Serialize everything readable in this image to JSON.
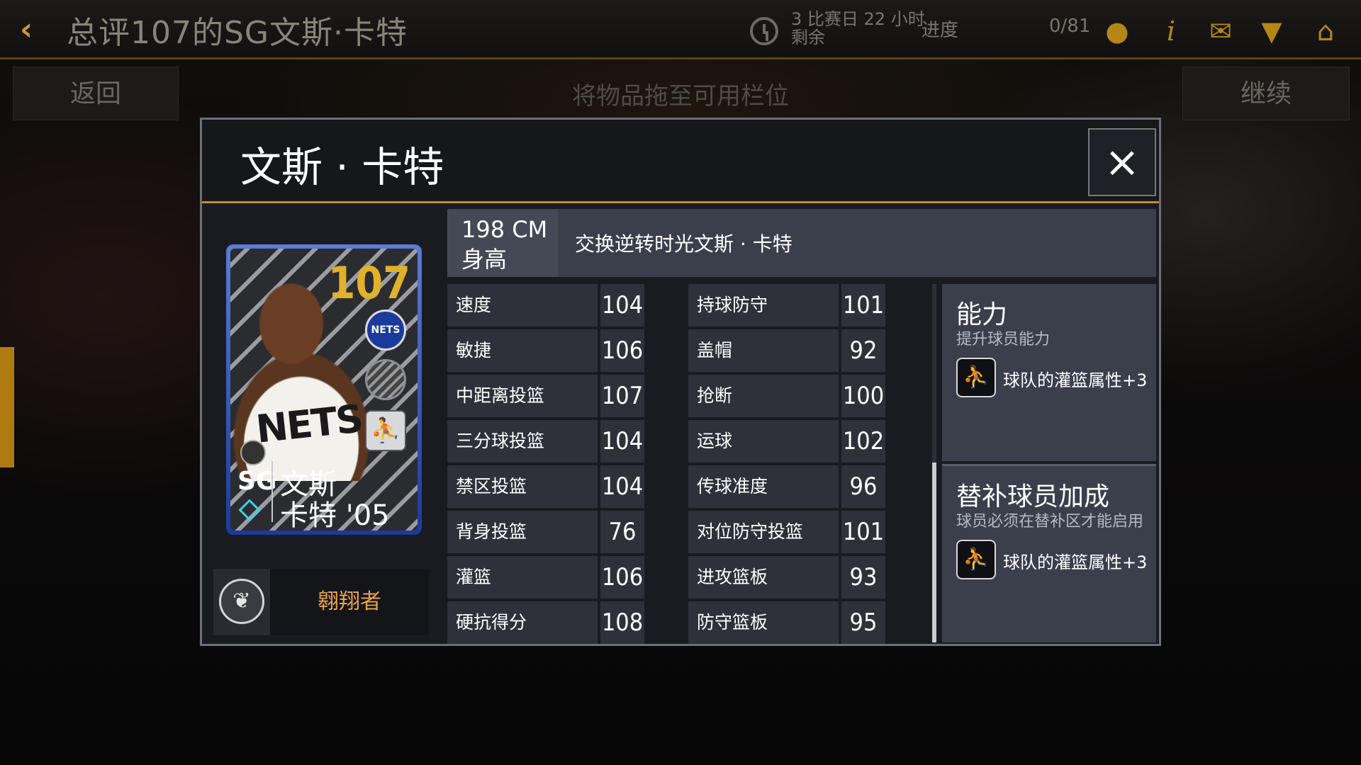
{
  "top_bar": {
    "title": "总评107的SG文斯·卡特",
    "timer": "3 比赛日 22 小时 剩余",
    "progress_label": "进度",
    "progress_value": "0/81"
  },
  "sub_bar": {
    "back_label": "返回",
    "hint": "将物品拖至可用栏位",
    "continue_label": "继续"
  },
  "modal": {
    "title": "文斯 · 卡特",
    "close_icon": "×"
  },
  "card": {
    "rating": "107",
    "position": "SG",
    "name_line1": "文斯",
    "name_line2": "卡特 '05",
    "jersey": "NETS",
    "team_logo": "NETS"
  },
  "trait": {
    "label": "翱翔者"
  },
  "info": {
    "height_value": "198 CM",
    "height_label": "身高",
    "description": "交换逆转时光文斯 · 卡特"
  },
  "stats_left": [
    {
      "label": "速度",
      "value": "104"
    },
    {
      "label": "敏捷",
      "value": "106"
    },
    {
      "label": "中距离投篮",
      "value": "107"
    },
    {
      "label": "三分球投篮",
      "value": "104"
    },
    {
      "label": "禁区投篮",
      "value": "104"
    },
    {
      "label": "背身投篮",
      "value": "76"
    },
    {
      "label": "灌篮",
      "value": "106"
    },
    {
      "label": "硬抗得分",
      "value": "108"
    }
  ],
  "stats_right": [
    {
      "label": "持球防守",
      "value": "101"
    },
    {
      "label": "盖帽",
      "value": "92"
    },
    {
      "label": "抢断",
      "value": "100"
    },
    {
      "label": "运球",
      "value": "102"
    },
    {
      "label": "传球准度",
      "value": "96"
    },
    {
      "label": "对位防守投篮",
      "value": "101"
    },
    {
      "label": "进攻篮板",
      "value": "93"
    },
    {
      "label": "防守篮板",
      "value": "95"
    }
  ],
  "abilities": [
    {
      "title": "能力",
      "subtitle": "提升球员能力",
      "effect": "球队的灌篮属性+3"
    },
    {
      "title": "替补球员加成",
      "subtitle": "球员必须在替补区才能启用",
      "effect": "球队的灌篮属性+3"
    }
  ]
}
